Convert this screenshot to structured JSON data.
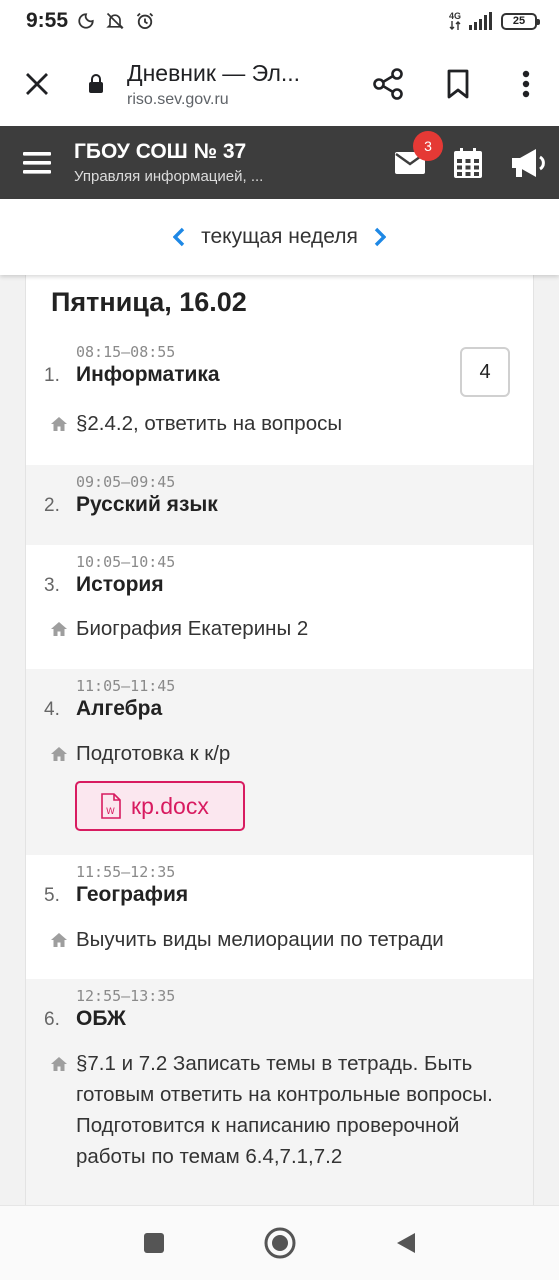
{
  "status_bar": {
    "time": "9:55",
    "network": "4G",
    "battery": "25"
  },
  "browser": {
    "page_title": "Дневник — Эл...",
    "url": "riso.sev.gov.ru"
  },
  "app_header": {
    "school_name": "ГБОУ СОШ № 37",
    "subtitle": "Управляя информацией, ...",
    "mail_badge": "3"
  },
  "week_nav": {
    "label": "текущая неделя"
  },
  "day": {
    "title": "Пятница, 16.02",
    "lessons": [
      {
        "num": "1.",
        "time": "08:15–08:55",
        "subject": "Информатика",
        "homework": "§2.4.2, ответить на вопросы",
        "grade": "4"
      },
      {
        "num": "2.",
        "time": "09:05–09:45",
        "subject": "Русский язык"
      },
      {
        "num": "3.",
        "time": "10:05–10:45",
        "subject": "История",
        "homework": "Биография Екатерины 2"
      },
      {
        "num": "4.",
        "time": "11:05–11:45",
        "subject": "Алгебра",
        "homework": "Подготовка к к/р",
        "attachment": "кр.docx"
      },
      {
        "num": "5.",
        "time": "11:55–12:35",
        "subject": "География",
        "homework": "Выучить виды мелиорации по тетради"
      },
      {
        "num": "6.",
        "time": "12:55–13:35",
        "subject": "ОБЖ",
        "homework": "§7.1 и 7.2 Записать темы в тетрадь. Быть готовым ответить на контрольные вопросы. Подготовится к написанию проверочной работы по темам 6.4,7.1,7.2"
      }
    ]
  },
  "colors": {
    "header_bg": "#3d3d3d",
    "accent_blue": "#1e88e5",
    "badge_red": "#e53935",
    "attachment_pink": "#d81b60"
  }
}
